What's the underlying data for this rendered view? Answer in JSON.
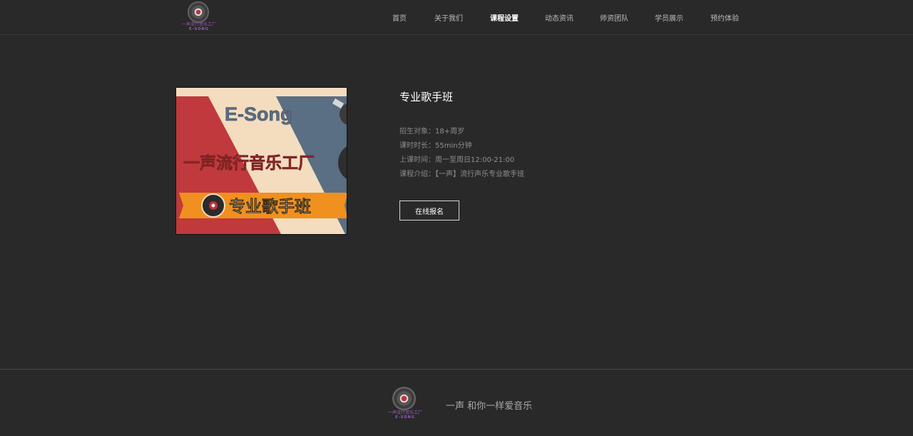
{
  "brand": {
    "logo_cn": "一声流行音乐工厂",
    "logo_en": "E-SONG",
    "accent_color": "#a05bc0"
  },
  "nav": {
    "items": [
      {
        "label": "首页",
        "active": false
      },
      {
        "label": "关于我们",
        "active": false
      },
      {
        "label": "课程设置",
        "active": true
      },
      {
        "label": "动态资讯",
        "active": false
      },
      {
        "label": "师资团队",
        "active": false
      },
      {
        "label": "学员展示",
        "active": false
      },
      {
        "label": "预约体验",
        "active": false
      }
    ]
  },
  "banner": {
    "brand_text": "E-Song",
    "headline": "一声流行音乐工厂",
    "ribbon_text": "专业歌手班",
    "colors": {
      "red": "#c0393c",
      "cream": "#f4dcbf",
      "slate": "#5a6e84",
      "orange": "#f0901e"
    }
  },
  "course": {
    "title": "专业歌手班",
    "details": [
      {
        "key": "招生对象：",
        "value": "18+周岁"
      },
      {
        "key": "课时时长：",
        "value": "55min分钟"
      },
      {
        "key": "上课时间：",
        "value": "周一至周日12:00-21:00"
      },
      {
        "key": "课程介绍：",
        "value": "【一声】流行声乐专业歌手班"
      }
    ],
    "signup_label": "在线报名"
  },
  "footer": {
    "slogan": "一声 和你一样爱音乐"
  }
}
